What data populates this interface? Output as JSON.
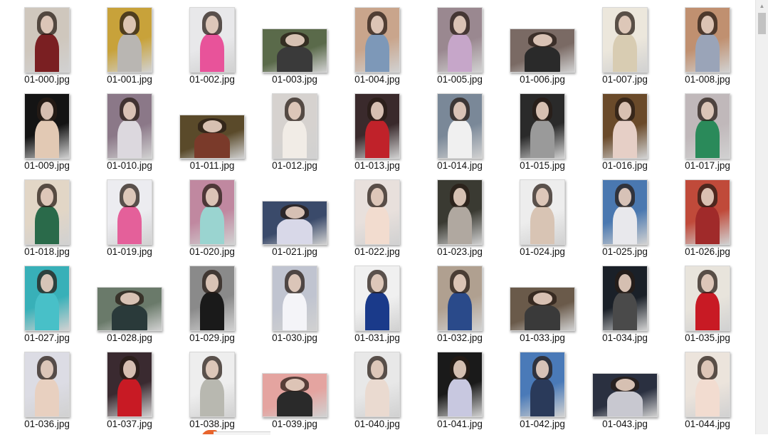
{
  "window": {
    "title": ""
  },
  "files": [
    {
      "name": "01-000.jpg",
      "orient": "portrait",
      "bg": "#cfc7bd",
      "fg": "#7a1f22"
    },
    {
      "name": "01-001.jpg",
      "orient": "portrait",
      "bg": "#c8a23a",
      "fg": "#b9b6b2"
    },
    {
      "name": "01-002.jpg",
      "orient": "portrait",
      "bg": "#e8e8ea",
      "fg": "#e8539a"
    },
    {
      "name": "01-003.jpg",
      "orient": "landscape",
      "bg": "#5a6a4a",
      "fg": "#3a3a3a"
    },
    {
      "name": "01-004.jpg",
      "orient": "portrait",
      "bg": "#c9a58c",
      "fg": "#7d98b8"
    },
    {
      "name": "01-005.jpg",
      "orient": "portrait",
      "bg": "#9a8890",
      "fg": "#c6a6c9"
    },
    {
      "name": "01-006.jpg",
      "orient": "landscape",
      "bg": "#7a6a64",
      "fg": "#2a2a2a"
    },
    {
      "name": "01-007.jpg",
      "orient": "portrait",
      "bg": "#ece7dc",
      "fg": "#d8ccb2"
    },
    {
      "name": "01-008.jpg",
      "orient": "portrait",
      "bg": "#c09070",
      "fg": "#9aa4b8"
    },
    {
      "name": "01-009.jpg",
      "orient": "portrait",
      "bg": "#141414",
      "fg": "#e2c9b4"
    },
    {
      "name": "01-010.jpg",
      "orient": "portrait",
      "bg": "#8b7888",
      "fg": "#dcd8de"
    },
    {
      "name": "01-011.jpg",
      "orient": "landscape",
      "bg": "#5a4a2a",
      "fg": "#7a3a2a"
    },
    {
      "name": "01-012.jpg",
      "orient": "portrait",
      "bg": "#d6d2cf",
      "fg": "#f1ece6"
    },
    {
      "name": "01-013.jpg",
      "orient": "portrait",
      "bg": "#3a2a2c",
      "fg": "#c0222a"
    },
    {
      "name": "01-014.jpg",
      "orient": "portrait",
      "bg": "#7a8898",
      "fg": "#f0f0f0"
    },
    {
      "name": "01-015.jpg",
      "orient": "portrait",
      "bg": "#2a2a2a",
      "fg": "#9a9a9a"
    },
    {
      "name": "01-016.jpg",
      "orient": "portrait",
      "bg": "#6a4a2a",
      "fg": "#e6cfc6"
    },
    {
      "name": "01-017.jpg",
      "orient": "portrait",
      "bg": "#c0b8ba",
      "fg": "#2a8a5a"
    },
    {
      "name": "01-018.jpg",
      "orient": "portrait",
      "bg": "#e2d6c6",
      "fg": "#2a6a4a"
    },
    {
      "name": "01-019.jpg",
      "orient": "portrait",
      "bg": "#ececf0",
      "fg": "#e4609a"
    },
    {
      "name": "01-020.jpg",
      "orient": "portrait",
      "bg": "#c088a0",
      "fg": "#9ad4d0"
    },
    {
      "name": "01-021.jpg",
      "orient": "landscape",
      "bg": "#3a4a6a",
      "fg": "#d8d8e8"
    },
    {
      "name": "01-022.jpg",
      "orient": "portrait",
      "bg": "#e8e0dc",
      "fg": "#f2dccf"
    },
    {
      "name": "01-023.jpg",
      "orient": "portrait",
      "bg": "#3a3a32",
      "fg": "#b0a8a0"
    },
    {
      "name": "01-024.jpg",
      "orient": "portrait",
      "bg": "#ededed",
      "fg": "#d8c4b4"
    },
    {
      "name": "01-025.jpg",
      "orient": "portrait",
      "bg": "#4a78b0",
      "fg": "#e8e8ec"
    },
    {
      "name": "01-026.jpg",
      "orient": "portrait",
      "bg": "#c04a3a",
      "fg": "#a02a2a"
    },
    {
      "name": "01-027.jpg",
      "orient": "portrait",
      "bg": "#38b0b8",
      "fg": "#48c0c8"
    },
    {
      "name": "01-028.jpg",
      "orient": "landscape",
      "bg": "#6a7a6a",
      "fg": "#2a3a3a"
    },
    {
      "name": "01-029.jpg",
      "orient": "portrait",
      "bg": "#8a8a8a",
      "fg": "#1a1a1a"
    },
    {
      "name": "01-030.jpg",
      "orient": "portrait",
      "bg": "#c0c4d0",
      "fg": "#f4f4f8"
    },
    {
      "name": "01-031.jpg",
      "orient": "portrait",
      "bg": "#f0f0f0",
      "fg": "#1a3a8a"
    },
    {
      "name": "01-032.jpg",
      "orient": "portrait",
      "bg": "#b0a090",
      "fg": "#2a4a8a"
    },
    {
      "name": "01-033.jpg",
      "orient": "landscape",
      "bg": "#6a5a4a",
      "fg": "#3a3a3a"
    },
    {
      "name": "01-034.jpg",
      "orient": "portrait",
      "bg": "#1a2028",
      "fg": "#4a4a4a"
    },
    {
      "name": "01-035.jpg",
      "orient": "portrait",
      "bg": "#e8e4dc",
      "fg": "#c81a24"
    },
    {
      "name": "01-036.jpg",
      "orient": "portrait",
      "bg": "#dcdce4",
      "fg": "#e8d0c0"
    },
    {
      "name": "01-037.jpg",
      "orient": "portrait",
      "bg": "#3a2a30",
      "fg": "#c81a24"
    },
    {
      "name": "01-038.jpg",
      "orient": "portrait",
      "bg": "#eeeeee",
      "fg": "#b8b8b0"
    },
    {
      "name": "01-039.jpg",
      "orient": "landscape",
      "bg": "#e4a4a0",
      "fg": "#2a2a2a"
    },
    {
      "name": "01-040.jpg",
      "orient": "portrait",
      "bg": "#e8e8e8",
      "fg": "#eadad0"
    },
    {
      "name": "01-041.jpg",
      "orient": "portrait",
      "bg": "#1a1a1a",
      "fg": "#c8c8e0"
    },
    {
      "name": "01-042.jpg",
      "orient": "portrait",
      "bg": "#4a7ab8",
      "fg": "#2a3a5a"
    },
    {
      "name": "01-043.jpg",
      "orient": "landscape",
      "bg": "#2a3040",
      "fg": "#c8c8d0"
    },
    {
      "name": "01-044.jpg",
      "orient": "portrait",
      "bg": "#ece4dc",
      "fg": "#f2dcd0"
    }
  ],
  "scrollbar": {
    "up_arrow": "▲"
  }
}
